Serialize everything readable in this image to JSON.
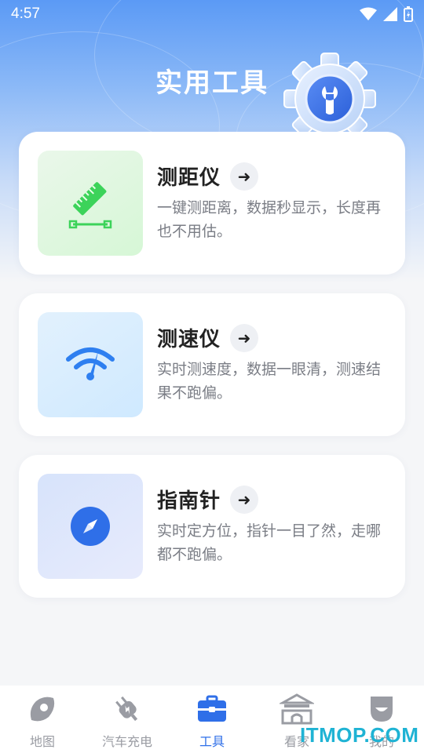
{
  "status": {
    "time": "4:57"
  },
  "page": {
    "title": "实用工具"
  },
  "tools": [
    {
      "name": "测距仪",
      "desc": "一键测距离，数据秒显示，长度再也不用估。",
      "arrow": "➜",
      "icon": "ruler-icon"
    },
    {
      "name": "测速仪",
      "desc": "实时测速度，数据一眼清，测速结果不跑偏。",
      "arrow": "➜",
      "icon": "speedometer-icon"
    },
    {
      "name": "指南针",
      "desc": "实时定方位，指针一目了然，走哪都不跑偏。",
      "arrow": "➜",
      "icon": "compass-icon"
    }
  ],
  "tabs": [
    {
      "label": "地图",
      "icon": "map-icon",
      "active": false
    },
    {
      "label": "汽车充电",
      "icon": "charging-plug-icon",
      "active": false
    },
    {
      "label": "工具",
      "icon": "toolbox-icon",
      "active": true
    },
    {
      "label": "看家",
      "icon": "gate-icon",
      "active": false
    },
    {
      "label": "我的",
      "icon": "profile-icon",
      "active": false
    }
  ],
  "watermark": "ITMOP.COM",
  "colors": {
    "accent": "#2f6fe8",
    "inactive": "#9a9ca3"
  }
}
